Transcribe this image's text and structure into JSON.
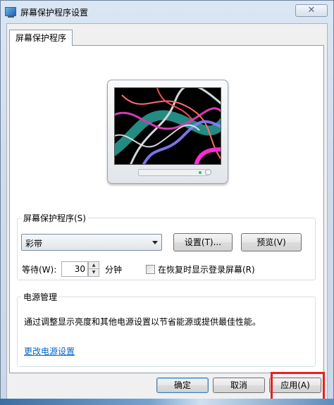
{
  "window": {
    "title": "屏幕保护程序设置",
    "close_glyph": "✕"
  },
  "tabs": [
    {
      "label": "屏幕保护程序"
    }
  ],
  "screensaver_group": {
    "legend": "屏幕保护程序(S)",
    "selected": "彩带",
    "settings_button": "设置(T)...",
    "preview_button": "预览(V)",
    "wait_label": "等待(W):",
    "wait_value": "30",
    "wait_unit": "分钟",
    "resume_checkbox_label": "在恢复时显示登录屏幕(R)",
    "resume_checked": false
  },
  "power_group": {
    "legend": "电源管理",
    "description": "通过调整显示亮度和其他电源设置以节省能源或提供最佳性能。",
    "link": "更改电源设置"
  },
  "buttons": {
    "ok": "确定",
    "cancel": "取消",
    "apply": "应用(A)"
  },
  "colors": {
    "highlight_box": "#e32222",
    "link": "#0066cc"
  }
}
